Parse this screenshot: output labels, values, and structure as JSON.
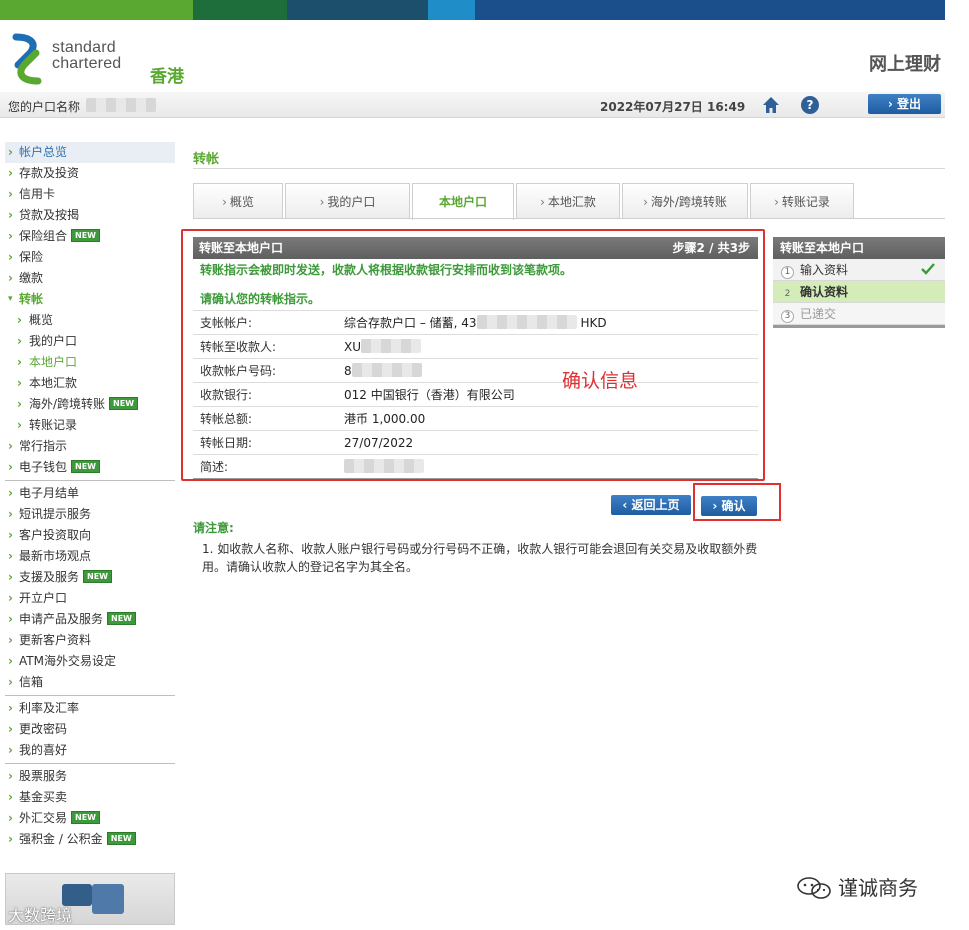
{
  "colors": {
    "green": "#5aa832",
    "dark_green": "#3d9a3a",
    "blue": "#1f5ca0",
    "red": "#e03030",
    "bar1": "#5aa832",
    "bar2": "#1d6e3a",
    "bar3": "#1c4f6b",
    "bar4": "#1f8dc8",
    "bar5": "#1a4f8b"
  },
  "header": {
    "brand_line1": "standard",
    "brand_line2": "chartered",
    "brand_region": "香港",
    "site_title": "网上理财",
    "account_name_label": "您的户口名称",
    "datetime": "2022年07月27日 16:49",
    "logout_label": "登出",
    "help_glyph": "?"
  },
  "sidebar": {
    "groups": [
      [
        {
          "label": "帐户总览",
          "active": true
        },
        {
          "label": "存款及投资"
        },
        {
          "label": "信用卡"
        },
        {
          "label": "贷款及按揭"
        },
        {
          "label": "保险组合",
          "new": true
        },
        {
          "label": "保险"
        },
        {
          "label": "缴款"
        },
        {
          "label": "转帐",
          "open": true
        },
        {
          "label": "概览",
          "sub": true
        },
        {
          "label": "我的户口",
          "sub": true
        },
        {
          "label": "本地户口",
          "sub": true,
          "current": true
        },
        {
          "label": "本地汇款",
          "sub": true
        },
        {
          "label": "海外/跨境转账",
          "sub": true,
          "new": true
        },
        {
          "label": "转账记录",
          "sub": true
        },
        {
          "label": "常行指示"
        },
        {
          "label": "电子钱包",
          "new": true
        }
      ],
      [
        {
          "label": "电子月结单"
        },
        {
          "label": "短讯提示服务"
        },
        {
          "label": "客户投资取向"
        },
        {
          "label": "最新市场观点"
        },
        {
          "label": "支援及服务",
          "new": true
        },
        {
          "label": "开立户口"
        },
        {
          "label": "申请产品及服务",
          "new": true
        },
        {
          "label": "更新客户资料"
        },
        {
          "label": "ATM海外交易设定"
        },
        {
          "label": "信箱"
        }
      ],
      [
        {
          "label": "利率及汇率"
        },
        {
          "label": "更改密码"
        },
        {
          "label": "我的喜好"
        }
      ],
      [
        {
          "label": "股票服务"
        },
        {
          "label": "基金买卖"
        },
        {
          "label": "外汇交易",
          "new": true
        },
        {
          "label": "强积金 / 公积金",
          "new": true
        }
      ]
    ],
    "new_badge": "NEW"
  },
  "main": {
    "page_title": "转帐",
    "tabs": [
      {
        "label": "概览",
        "width": 90
      },
      {
        "label": "我的户口",
        "width": 125
      },
      {
        "label": "本地户口",
        "width": 102,
        "active": true
      },
      {
        "label": "本地汇款",
        "width": 104
      },
      {
        "label": "海外/跨境转账",
        "width": 126
      },
      {
        "label": "转账记录",
        "width": 104
      }
    ],
    "panel": {
      "title": "转账至本地户口",
      "step_text": "步骤2 / 共3步",
      "notice": "转账指示会被即时发送，收款人将根据收款银行安排而收到该笔款项。",
      "confirm_label": "请确认您的转帐指示。",
      "rows": [
        {
          "label": "支帐帐户:",
          "value": "综合存款户口 – 储蓄, 43",
          "suffix": "HKD",
          "blur": 100
        },
        {
          "label": "转帐至收款人:",
          "value": "XU",
          "blur": 60
        },
        {
          "label": "收款帐户号码:",
          "value": "8",
          "blur": 70
        },
        {
          "label": "收款银行:",
          "value": "012 中国银行（香港）有限公司"
        },
        {
          "label": "转帐总额:",
          "value": "港币   1,000.00"
        },
        {
          "label": "转帐日期:",
          "value": "27/07/2022"
        },
        {
          "label": "简述:",
          "value": "",
          "blur": 80
        }
      ]
    },
    "annotation": "确认信息",
    "back_label": "返回上页",
    "confirm_btn_label": "确认",
    "note_title": "请注意:",
    "note_text": "1. 如收款人名称、收款人账户银行号码或分行号码不正确，收款人银行可能会退回有关交易及收取额外费用。请确认收款人的登记名字为其全名。"
  },
  "steps_box": {
    "title": "转账至本地户口",
    "steps": [
      {
        "num": "1",
        "label": "输入资料",
        "state": "done"
      },
      {
        "num": "2",
        "label": "确认资料",
        "state": "current"
      },
      {
        "num": "3",
        "label": "已递交",
        "state": "pending"
      }
    ]
  },
  "watermarks": {
    "right": "谨诚商务",
    "left": "大数跨境"
  }
}
